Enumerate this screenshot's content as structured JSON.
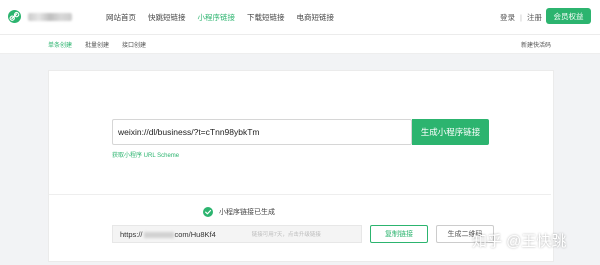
{
  "nav": {
    "items": [
      {
        "label": "网站首页",
        "active": false
      },
      {
        "label": "快跳短链接",
        "active": false
      },
      {
        "label": "小程序链接",
        "active": true
      },
      {
        "label": "下载短链接",
        "active": false
      },
      {
        "label": "电商短链接",
        "active": false
      }
    ],
    "login": "登录",
    "separator": "|",
    "register": "注册",
    "vip_button": "会员权益"
  },
  "subtabs": {
    "single": "单条创建",
    "batch": "批量创建",
    "api": "接口创建",
    "new_code": "新建快活码"
  },
  "generator": {
    "input_value": "weixin://dl/business/?t=cTnn98ybkTm",
    "generate_button": "生成小程序链接",
    "scheme_link": "获取小程序 URL Scheme"
  },
  "result": {
    "status_text": "小程序链接已生成",
    "url_prefix": "https://",
    "url_suffix": "com/Hu8Kf4",
    "note": "链接可用7天，点击升级链接",
    "copy_button": "复制链接",
    "qr_button": "生成二维码"
  },
  "watermark": "知乎 @王快跳",
  "colors": {
    "accent": "#2cb46f"
  }
}
